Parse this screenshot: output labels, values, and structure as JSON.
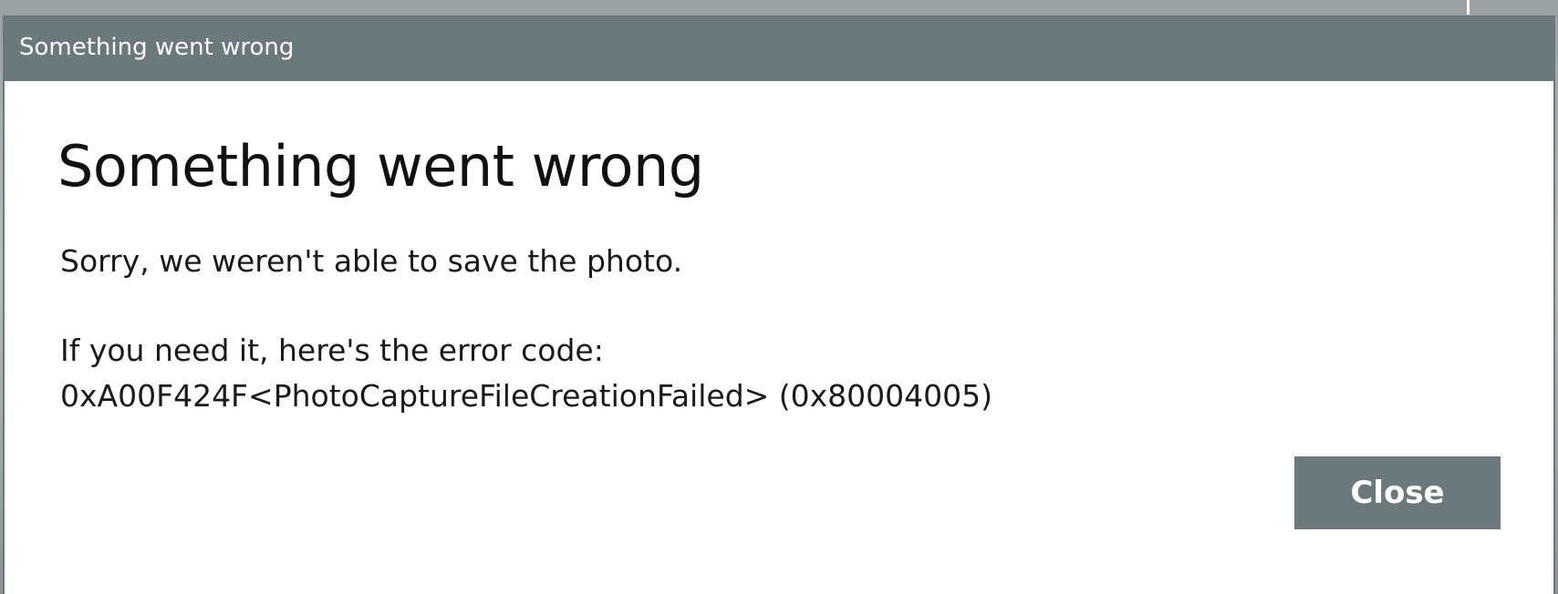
{
  "window": {
    "title": "Something went wrong"
  },
  "dialog": {
    "heading": "Something went wrong",
    "message": "Sorry, we weren't able to save the photo.",
    "error_label": "If you need it, here's the error code:",
    "error_code": "0xA00F424F<PhotoCaptureFileCreationFailed> (0x80004005)",
    "close_label": "Close"
  },
  "colors": {
    "titlebar": "#6b797d",
    "button": "#6b797d",
    "background": "#ffffff"
  }
}
